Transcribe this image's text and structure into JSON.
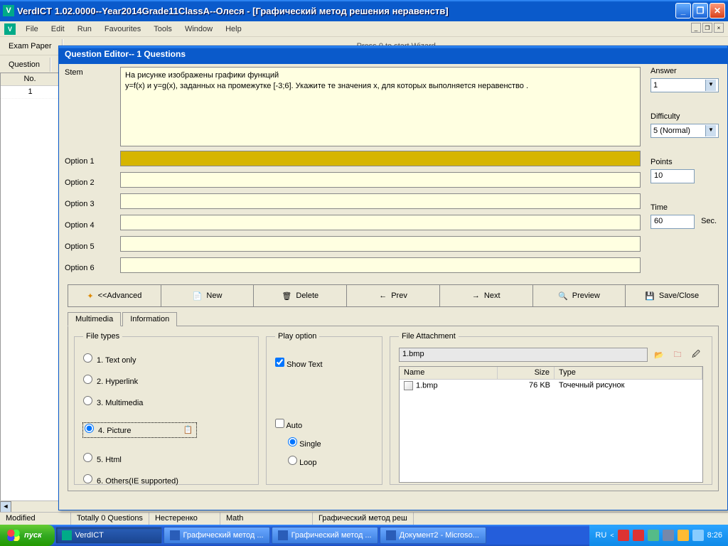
{
  "window": {
    "title": "VerdICT 1.02.0000--Year2014Grade11ClassA--Олеся - [Графический метод решения неравенств]"
  },
  "menu": {
    "items": [
      "File",
      "Edit",
      "Run",
      "Favourites",
      "Tools",
      "Window",
      "Help"
    ]
  },
  "toolbar": {
    "label1": "Exam Paper",
    "label2": "Question",
    "wizard": "Press 0 to start Wizard"
  },
  "leftlist": {
    "col1": "No.",
    "rows": [
      "1"
    ]
  },
  "dialog": {
    "title": "Question Editor-- 1 Questions"
  },
  "stem": {
    "label": "Stem",
    "line1": "На рисунке изображены графики функций",
    "line2": " y=f(x) и  y=g(x), заданных на промежутке  [-3;6]. Укажите те значения  x,  для которых выполняется неравенство   .",
    "opts": [
      "Option 1",
      "Option 2",
      "Option 3",
      "Option 4",
      "Option 5",
      "Option 6"
    ]
  },
  "right": {
    "answer_label": "Answer",
    "answer_val": "1",
    "diff_label": "Difficulty",
    "diff_val": "5 (Normal)",
    "points_label": "Points",
    "points_val": "10",
    "time_label": "Time",
    "time_val": "60",
    "time_unit": "Sec."
  },
  "btns": {
    "adv": "<<Advanced",
    "new": "New",
    "del": "Delete",
    "prev": "Prev",
    "next": "Next",
    "preview": "Preview",
    "save": "Save/Close"
  },
  "tabs": {
    "t1": "Multimedia",
    "t2": "Information"
  },
  "filetypes": {
    "legend": "File types",
    "o1": "1. Text only",
    "o2": "2. Hyperlink",
    "o3": "3. Multimedia",
    "o4": "4. Picture",
    "o5": "5. Html",
    "o6": "6. Others(IE supported)"
  },
  "playopt": {
    "legend": "Play option",
    "show": "Show Text",
    "auto": "Auto",
    "single": "Single",
    "loop": "Loop"
  },
  "fattach": {
    "legend": "File Attachment",
    "path": "1.bmp",
    "h1": "Name",
    "h2": "Size",
    "h3": "Type",
    "r_name": "1.bmp",
    "r_size": "76 KB",
    "r_type": "Точечный рисунок"
  },
  "status": {
    "s1": "Modified",
    "s2": "Totally 0 Questions",
    "s3": "Нестеренко",
    "s4": "Math",
    "s5": "Графический метод реш"
  },
  "taskbar": {
    "start": "пуск",
    "b1": "VerdICT",
    "b2": "Графический метод ...",
    "b3": "Графический метод ...",
    "b4": "Документ2 - Microso...",
    "lang": "RU",
    "clock": "8:26"
  }
}
